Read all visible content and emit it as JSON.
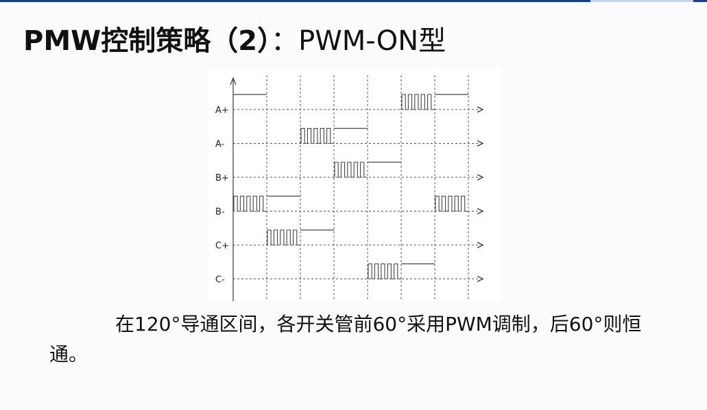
{
  "slide": {
    "title_bold": "PMW控制策略（2）",
    "title_normal": "：PWM-ON型",
    "caption": "在120°导通区间，各开关管前60°采用PWM调制，后60°则恒通。"
  },
  "diagram": {
    "rows": [
      {
        "label": "A+",
        "segments": [
          {
            "sector": 0,
            "mode": "on"
          },
          {
            "sector": 5,
            "mode": "pwm"
          },
          {
            "sector": 6,
            "mode": "on"
          }
        ]
      },
      {
        "label": "A-",
        "segments": [
          {
            "sector": 2,
            "mode": "pwm"
          },
          {
            "sector": 3,
            "mode": "on"
          }
        ]
      },
      {
        "label": "B+",
        "segments": [
          {
            "sector": 3,
            "mode": "pwm"
          },
          {
            "sector": 4,
            "mode": "on"
          }
        ]
      },
      {
        "label": "B-",
        "segments": [
          {
            "sector": 0,
            "mode": "pwm"
          },
          {
            "sector": 1,
            "mode": "on"
          },
          {
            "sector": 6,
            "mode": "pwm"
          }
        ]
      },
      {
        "label": "C+",
        "segments": [
          {
            "sector": 1,
            "mode": "pwm"
          },
          {
            "sector": 2,
            "mode": "on"
          }
        ]
      },
      {
        "label": "C-",
        "segments": [
          {
            "sector": 4,
            "mode": "pwm"
          },
          {
            "sector": 5,
            "mode": "on"
          }
        ]
      }
    ],
    "sector_count": 7,
    "pulses_per_pwm": 5,
    "colors": {
      "line": "#3a3a3a",
      "grid": "#555555",
      "signal": "#444444"
    }
  }
}
